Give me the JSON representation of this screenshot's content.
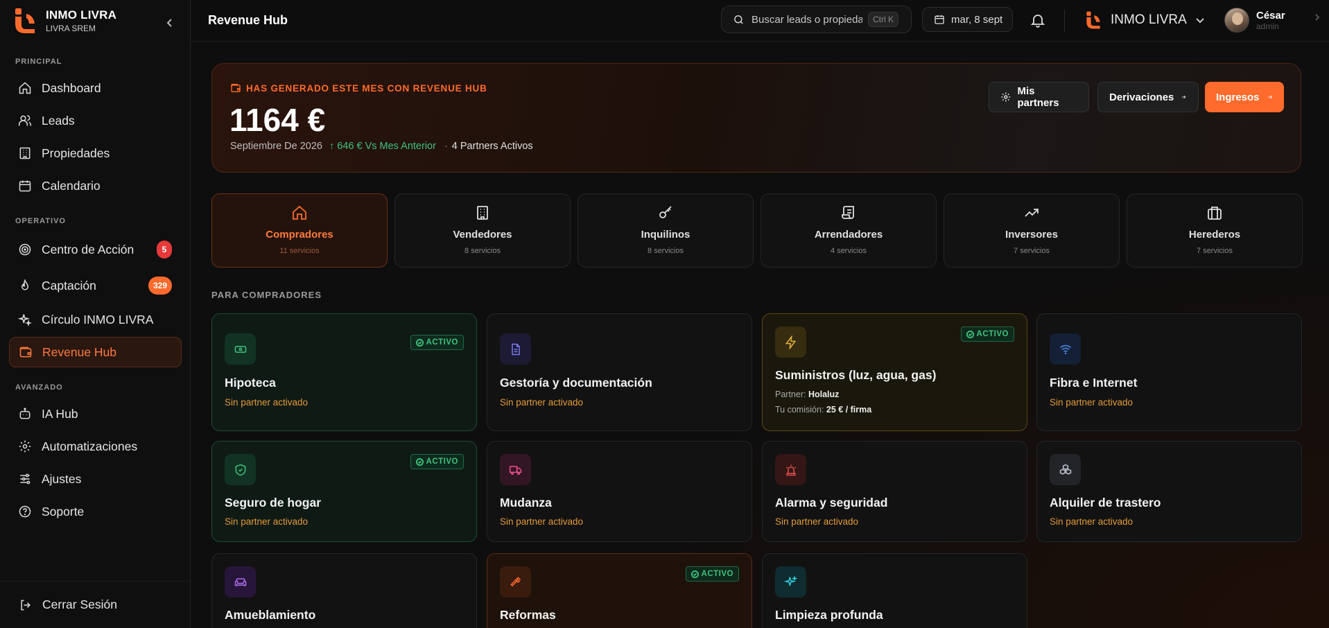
{
  "brand": {
    "name": "INMO LIVRA",
    "sub": "LIVRA SREM"
  },
  "sidebar": {
    "sections": [
      "PRINCIPAL",
      "OPERATIVO",
      "AVANZADO"
    ],
    "items": [
      {
        "label": "Dashboard"
      },
      {
        "label": "Leads"
      },
      {
        "label": "Propiedades"
      },
      {
        "label": "Calendario"
      },
      {
        "label": "Centro de Acción",
        "badge": "5"
      },
      {
        "label": "Captación",
        "badge": "329"
      },
      {
        "label": "Círculo INMO LIVRA"
      },
      {
        "label": "Revenue Hub"
      },
      {
        "label": "IA Hub"
      },
      {
        "label": "Automatizaciones"
      },
      {
        "label": "Ajustes"
      },
      {
        "label": "Soporte"
      }
    ],
    "logout": "Cerrar Sesión"
  },
  "topbar": {
    "title": "Revenue Hub",
    "search_placeholder": "Buscar leads o propiedades...",
    "shortcut": "Ctrl K",
    "date": "mar, 8 sept",
    "org": "INMO LIVRA",
    "user_name": "César",
    "user_role": "admin"
  },
  "hero": {
    "label": "HAS GENERADO ESTE MES CON REVENUE HUB",
    "amount": "1164 €",
    "period": "Septiembre De 2026",
    "delta": "↑ 646 € Vs Mes Anterior",
    "dot": "·",
    "partners": "4 Partners Activos",
    "btn_partners": "Mis partners",
    "btn_deriv": "Derivaciones",
    "btn_ingresos": "Ingresos"
  },
  "categories": [
    {
      "title": "Compradores",
      "sub": "11 servicios"
    },
    {
      "title": "Vendedores",
      "sub": "8 servicios"
    },
    {
      "title": "Inquilinos",
      "sub": "8 servicios"
    },
    {
      "title": "Arrendadores",
      "sub": "4 servicios"
    },
    {
      "title": "Inversores",
      "sub": "7 servicios"
    },
    {
      "title": "Herederos",
      "sub": "7 servicios"
    }
  ],
  "section_title": "PARA COMPRADORES",
  "status_active": "ACTIVO",
  "cards": [
    {
      "title": "Hipoteca",
      "sub": "Sin partner activado"
    },
    {
      "title": "Gestoría y documentación",
      "sub": "Sin partner activado"
    },
    {
      "title": "Suministros (luz, agua, gas)",
      "partner_label": "Partner:",
      "partner": "Holaluz",
      "commission_label": "Tu comisión:",
      "commission": "25 € / firma"
    },
    {
      "title": "Fibra e Internet",
      "sub": "Sin partner activado"
    },
    {
      "title": "Seguro de hogar",
      "sub": "Sin partner activado"
    },
    {
      "title": "Mudanza",
      "sub": "Sin partner activado"
    },
    {
      "title": "Alarma y seguridad",
      "sub": "Sin partner activado"
    },
    {
      "title": "Alquiler de trastero",
      "sub": "Sin partner activado"
    },
    {
      "title": "Amueblamiento"
    },
    {
      "title": "Reformas"
    },
    {
      "title": "Limpieza profunda"
    }
  ],
  "colors": {
    "accent": "#ff6b2c",
    "success": "#3fc27c",
    "warning": "#e39a3b",
    "danger": "#e5393a"
  }
}
